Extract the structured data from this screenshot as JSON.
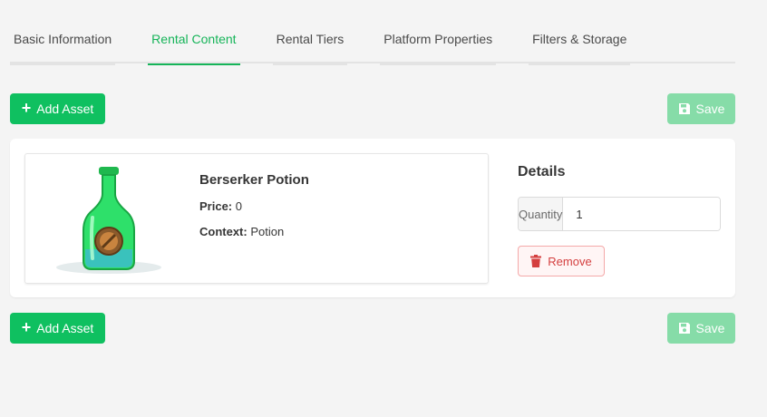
{
  "tabs": [
    {
      "label": "Basic Information",
      "active": false
    },
    {
      "label": "Rental Content",
      "active": true
    },
    {
      "label": "Rental Tiers",
      "active": false
    },
    {
      "label": "Platform Properties",
      "active": false
    },
    {
      "label": "Filters & Storage",
      "active": false
    }
  ],
  "toolbar": {
    "add_label": "Add Asset",
    "save_label": "Save",
    "add_icon": "plus-icon",
    "save_icon": "floppy-disk-icon"
  },
  "asset": {
    "name": "Berserker Potion",
    "price_label": "Price:",
    "price_value": "0",
    "context_label": "Context:",
    "context_value": "Potion",
    "image_icon": "green-potion-bottle"
  },
  "details": {
    "title": "Details",
    "quantity_label": "Quantity",
    "quantity_value": "1",
    "remove_label": "Remove",
    "remove_icon": "trash-icon"
  },
  "colors": {
    "accent": "#16b459",
    "add_button": "#0fc060",
    "save_button_disabled": "#86dca8",
    "remove": "#d43f3f"
  }
}
